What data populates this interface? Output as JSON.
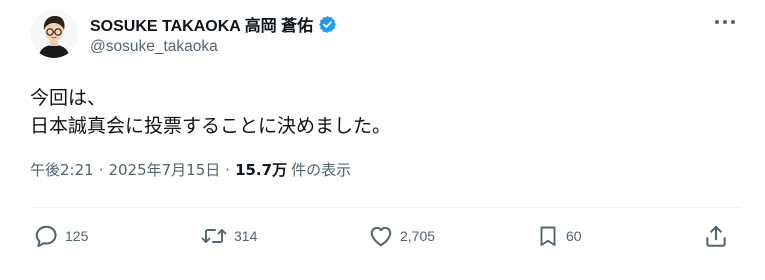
{
  "author": {
    "display_name": "SOSUKE TAKAOKA 高岡 蒼佑",
    "handle": "@sosuke_takaoka",
    "verified": true,
    "verified_color": "#1d9bf0"
  },
  "post": {
    "lines": [
      "今回は、",
      "日本誠真会に投票することに決めました。"
    ]
  },
  "meta": {
    "time": "午後2:21",
    "separator": "·",
    "date": "2025年7月15日",
    "views_count": "15.7万",
    "views_label": "件の表示"
  },
  "actions": {
    "replies": "125",
    "reposts": "314",
    "likes": "2,705",
    "bookmarks": "60"
  },
  "icons": [
    "more-icon",
    "reply-icon",
    "repost-icon",
    "like-icon",
    "bookmark-icon",
    "share-icon",
    "verified-badge-icon"
  ],
  "colors": {
    "text": "#0f1419",
    "secondary": "#536471",
    "divider": "#eff3f4"
  }
}
